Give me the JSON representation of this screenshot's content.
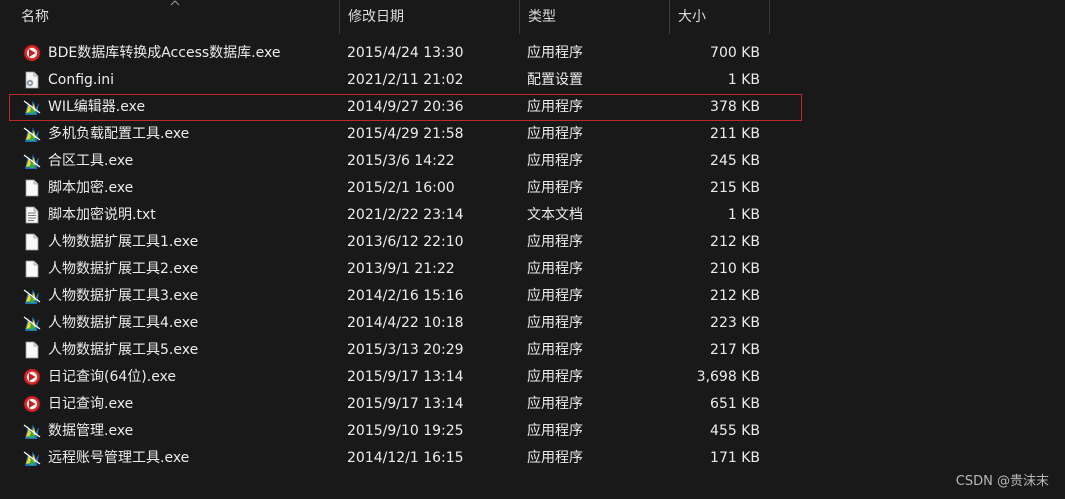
{
  "columns": {
    "name": "名称",
    "date": "修改日期",
    "type": "类型",
    "size": "大小"
  },
  "sort": {
    "column": "name",
    "direction": "ascending"
  },
  "files": [
    {
      "name": "BDE数据库转换成Access数据库.exe",
      "date": "2015/4/24 13:30",
      "type": "应用程序",
      "size": "700 KB",
      "icon": "red-app-icon"
    },
    {
      "name": "Config.ini",
      "date": "2021/2/11 21:02",
      "type": "配置设置",
      "size": "1 KB",
      "icon": "config-file-icon"
    },
    {
      "name": "WIL编辑器.exe",
      "date": "2014/9/27 20:36",
      "type": "应用程序",
      "size": "378 KB",
      "icon": "tool-app-icon",
      "selected": true
    },
    {
      "name": "多机负载配置工具.exe",
      "date": "2015/4/29 21:58",
      "type": "应用程序",
      "size": "211 KB",
      "icon": "tool-app-icon"
    },
    {
      "name": "合区工具.exe",
      "date": "2015/3/6 14:22",
      "type": "应用程序",
      "size": "245 KB",
      "icon": "tool-app-icon"
    },
    {
      "name": "脚本加密.exe",
      "date": "2015/2/1 16:00",
      "type": "应用程序",
      "size": "215 KB",
      "icon": "blank-file-icon"
    },
    {
      "name": "脚本加密说明.txt",
      "date": "2021/2/22 23:14",
      "type": "文本文档",
      "size": "1 KB",
      "icon": "text-file-icon"
    },
    {
      "name": "人物数据扩展工具1.exe",
      "date": "2013/6/12 22:10",
      "type": "应用程序",
      "size": "212 KB",
      "icon": "blank-file-icon"
    },
    {
      "name": "人物数据扩展工具2.exe",
      "date": "2013/9/1 21:22",
      "type": "应用程序",
      "size": "210 KB",
      "icon": "blank-file-icon"
    },
    {
      "name": "人物数据扩展工具3.exe",
      "date": "2014/2/16 15:16",
      "type": "应用程序",
      "size": "212 KB",
      "icon": "tool-app-icon"
    },
    {
      "name": "人物数据扩展工具4.exe",
      "date": "2014/4/22 10:18",
      "type": "应用程序",
      "size": "223 KB",
      "icon": "tool-app-icon"
    },
    {
      "name": "人物数据扩展工具5.exe",
      "date": "2015/3/13 20:29",
      "type": "应用程序",
      "size": "217 KB",
      "icon": "blank-file-icon"
    },
    {
      "name": "日记查询(64位).exe",
      "date": "2015/9/17 13:14",
      "type": "应用程序",
      "size": "3,698 KB",
      "icon": "red-app-icon"
    },
    {
      "name": "日记查询.exe",
      "date": "2015/9/17 13:14",
      "type": "应用程序",
      "size": "651 KB",
      "icon": "red-app-icon"
    },
    {
      "name": "数据管理.exe",
      "date": "2015/9/10 19:25",
      "type": "应用程序",
      "size": "455 KB",
      "icon": "tool-app-icon"
    },
    {
      "name": "远程账号管理工具.exe",
      "date": "2014/12/1 16:15",
      "type": "应用程序",
      "size": "171 KB",
      "icon": "tool-app-icon"
    }
  ],
  "watermark": "CSDN @贵沫末"
}
